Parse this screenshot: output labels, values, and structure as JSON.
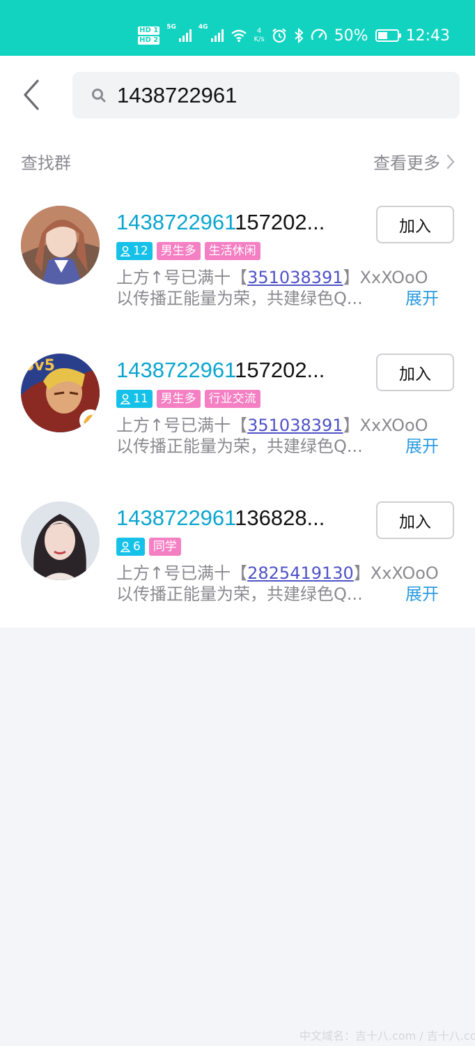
{
  "status_bar": {
    "hd1": "HD 1",
    "hd2": "HD 2",
    "net1": "5G",
    "net2": "4G",
    "speed_value": "4",
    "speed_unit": "K/s",
    "battery": "50%",
    "time": "12:43",
    "background_color": "#12d3c0",
    "icons": [
      "alarm-icon",
      "bluetooth-icon",
      "speed-gauge-icon",
      "battery-icon",
      "wifi-icon",
      "signal-icon"
    ]
  },
  "search": {
    "query": "1438722961",
    "back_icon": "chevron-left-icon",
    "search_icon": "search-icon"
  },
  "section": {
    "title": "查找群",
    "more_label": "查看更多",
    "more_icon": "chevron-right-icon"
  },
  "groups": [
    {
      "name_highlight": "1438722961",
      "name_rest": "157202...",
      "member_count": "12",
      "tags": [
        "男生多",
        "生活休闲"
      ],
      "desc_prefix": "上方↑号已满十【",
      "desc_link": "351038391",
      "desc_suffix": "】XxXOoO",
      "desc_line2": "以传播正能量为荣，共建绿色Q...",
      "expand_label": "展开",
      "join_label": "加入"
    },
    {
      "name_highlight": "1438722961",
      "name_rest": "157202...",
      "member_count": "11",
      "tags": [
        "男生多",
        "行业交流"
      ],
      "desc_prefix": "上方↑号已满十【",
      "desc_link": "351038391",
      "desc_suffix": "】XxXOoO",
      "desc_line2": "以传播正能量为荣，共建绿色Q...",
      "expand_label": "展开",
      "join_label": "加入"
    },
    {
      "name_highlight": "1438722961",
      "name_rest": "136828...",
      "member_count": "6",
      "tags": [
        "同学"
      ],
      "desc_prefix": "上方↑号已满十【",
      "desc_link": "2825419130",
      "desc_suffix": "】XxXOoO",
      "desc_line2": "以传播正能量为荣，共建绿色Q...",
      "expand_label": "展开",
      "join_label": "加入"
    }
  ],
  "colors": {
    "highlight": "#0aa5cf",
    "tag_count": "#15c1e8",
    "tag_pink": "#f57fc3",
    "link": "#4e52c7",
    "expand": "#2a9be0"
  },
  "watermark": "中文域名：吉十八.com / 吉十八.cc"
}
